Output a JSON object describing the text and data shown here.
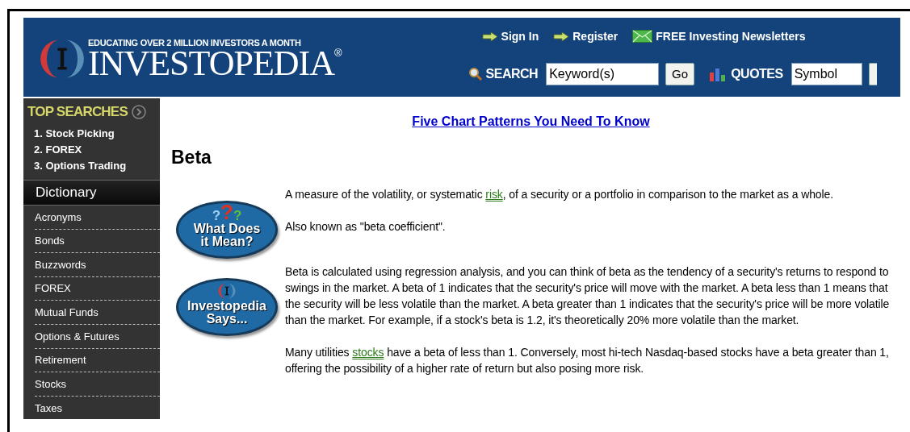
{
  "header": {
    "tagline": "EDUCATING OVER 2 MILLION INVESTORS A MONTH",
    "logo": "INVESTOPEDIA",
    "registered": "®",
    "links": [
      {
        "kind": "arrow",
        "label": "Sign In"
      },
      {
        "kind": "arrow",
        "label": "Register"
      },
      {
        "kind": "mail",
        "label": "FREE Investing Newsletters"
      }
    ],
    "search": {
      "label": "SEARCH",
      "placeholder": "Keyword(s)",
      "button": "Go"
    },
    "quotes": {
      "label": "QUOTES",
      "placeholder": "Symbol"
    }
  },
  "sidebar": {
    "top_searches_title": "TOP SEARCHES",
    "top_searches": [
      "1. Stock Picking",
      "2. FOREX",
      "3. Options Trading"
    ],
    "section_title": "Dictionary",
    "items": [
      "Acronyms",
      "Bonds",
      "Buzzwords",
      "FOREX",
      "Mutual Funds",
      "Options & Futures",
      "Retirement",
      "Stocks",
      "Taxes"
    ]
  },
  "content": {
    "promo_link": "Five Chart Patterns You Need To Know",
    "title": "Beta",
    "sections": [
      {
        "badge": {
          "kind": "question",
          "marks": [
            {
              "text": "?",
              "color": "#9cd0f5"
            },
            {
              "text": "?",
              "color": "#e03020"
            },
            {
              "text": "?",
              "color": "#5fbf3a"
            }
          ],
          "lines": [
            "What Does",
            "it Mean?"
          ]
        },
        "paragraphs": [
          [
            {
              "kind": "text",
              "text": "A measure of the volatility, or systematic "
            },
            {
              "kind": "link",
              "text": "risk"
            },
            {
              "kind": "text",
              "text": ", of a security or a portfolio in comparison to the market as a whole."
            }
          ],
          [
            {
              "kind": "text",
              "text": "Also known as \"beta coefficient\"."
            }
          ]
        ]
      },
      {
        "badge": {
          "kind": "logo",
          "lines": [
            "Investopedia",
            "Says..."
          ]
        },
        "paragraphs": [
          [
            {
              "kind": "text",
              "text": "Beta is calculated using regression analysis, and you can think of beta as the tendency of a security's returns to respond to swings in the market. A beta of 1 indicates that the security's price will move with the market. A beta less than 1 means that the security will be less volatile than the market. A beta greater than 1 indicates that the security's price will be more volatile than the market. For example, if a stock's beta is 1.2, it's theoretically 20% more volatile than the market."
            }
          ],
          [
            {
              "kind": "text",
              "text": "Many utilities "
            },
            {
              "kind": "link",
              "text": "stocks"
            },
            {
              "kind": "text",
              "text": " have a beta of less than 1. Conversely, most hi-tech Nasdaq-based stocks have a beta greater than 1, offering the possibility of a higher rate of return but also posing more risk."
            }
          ]
        ]
      }
    ]
  }
}
